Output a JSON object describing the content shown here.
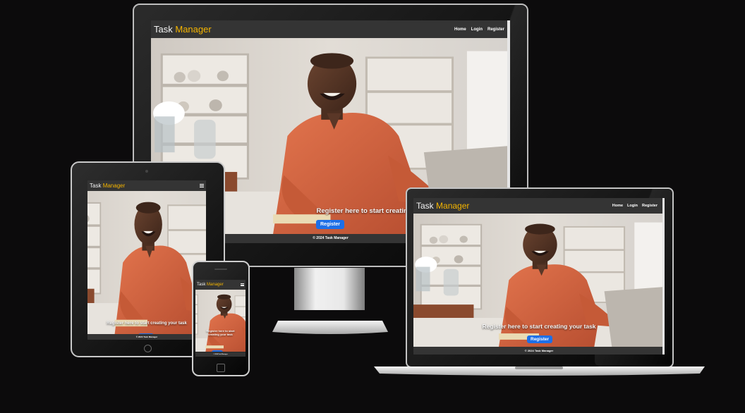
{
  "brand": {
    "word1": "Task",
    "word2": "Manager",
    "accent_color": "#f4b400"
  },
  "nav": {
    "home": "Home",
    "login": "Login",
    "register": "Register",
    "menu_icon": "hamburger-menu-icon"
  },
  "hero": {
    "cta_text": "Register here to start creating your task",
    "cta_text_phone": "Register here to start creating your task",
    "button_label": "Register"
  },
  "footer": {
    "copyright": "© 2024 Task Manager"
  },
  "colors": {
    "background": "#0c0b0c",
    "navbar": "#343434",
    "button": "#1d6fe8",
    "shirt": "#d5643f"
  }
}
